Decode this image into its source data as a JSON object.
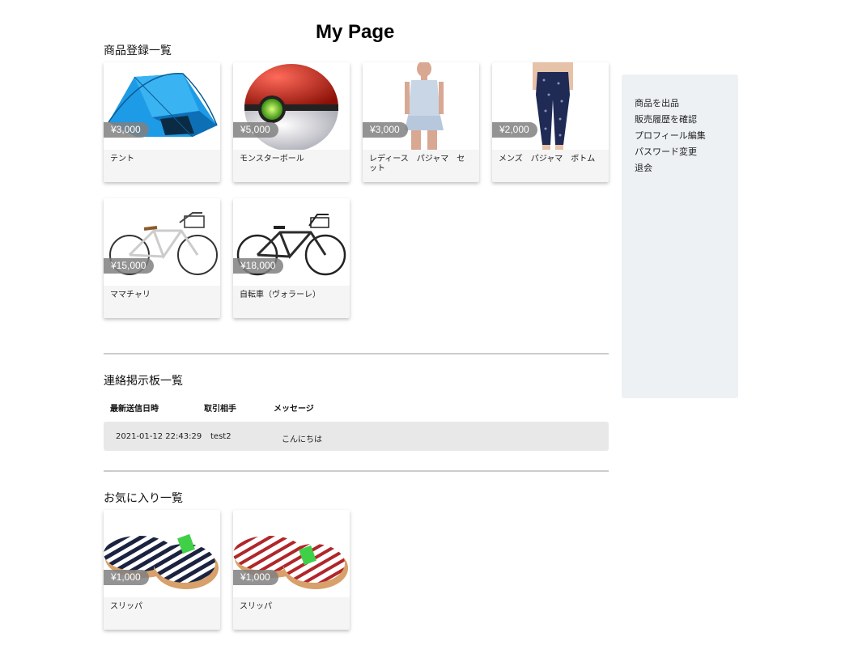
{
  "page_title": "My Page",
  "sections": {
    "listed": "商品登録一覧",
    "board": "連絡掲示板一覧",
    "favorites": "お気に入り一覧"
  },
  "listed_products": [
    {
      "name": "テント",
      "price": "¥3,000",
      "image": "tent"
    },
    {
      "name": "モンスターボール",
      "price": "¥5,000",
      "image": "monster-ball"
    },
    {
      "name": "レディース　パジャマ　セット",
      "price": "¥3,000",
      "image": "ladies-pajama"
    },
    {
      "name": "メンズ　パジャマ　ボトム",
      "price": "¥2,000",
      "image": "mens-pajama"
    },
    {
      "name": "ママチャリ",
      "price": "¥15,000",
      "image": "city-bicycle"
    },
    {
      "name": "自転車（ヴォラーレ）",
      "price": "¥18,000",
      "image": "bicycle"
    }
  ],
  "board": {
    "headers": [
      "最新送信日時",
      "取引相手",
      "メッセージ"
    ],
    "rows": [
      {
        "date": "2021-01-12 22:43:29",
        "partner": "test2",
        "message": "こんにちは"
      }
    ]
  },
  "favorite_products": [
    {
      "name": "スリッパ",
      "price": "¥1,000",
      "image": "slippers-navy"
    },
    {
      "name": "スリッパ",
      "price": "¥1,000",
      "image": "slippers-red"
    }
  ],
  "sidebar": {
    "items": [
      "商品を出品",
      "販売履歴を確認",
      "プロフィール編集",
      "パスワード変更",
      "退会"
    ]
  },
  "colors": {
    "card_bg": "#f5f5f5",
    "sidebar_bg": "#eef1f4",
    "price_badge": "#808080",
    "message_row": "#e8e8e8"
  }
}
